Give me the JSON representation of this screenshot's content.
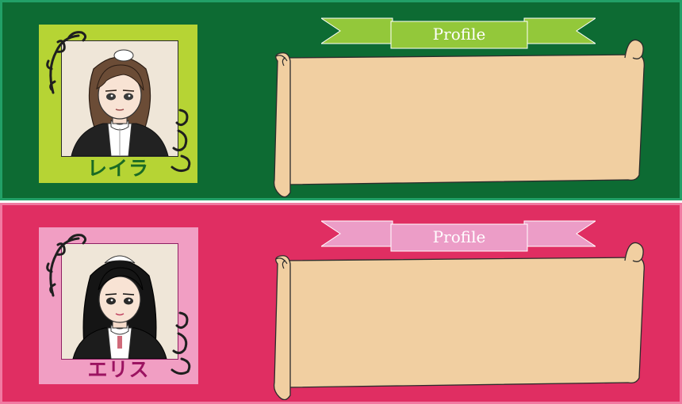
{
  "cards": [
    {
      "name": "レイラ",
      "profile_title": "Profile",
      "theme": "green",
      "colors": {
        "panel": "#0d6b33",
        "frame": "#b6d434",
        "ribbon": "#93c83a",
        "name": "#1a6a24"
      }
    },
    {
      "name": "エリス",
      "profile_title": "Profile",
      "theme": "pink",
      "colors": {
        "panel": "#e02e62",
        "frame": "#f19ec3",
        "ribbon": "#ec9dc7",
        "name": "#9c1361"
      }
    }
  ],
  "icons": [
    "maid-portrait",
    "corner-swirl-ornament",
    "ribbon-banner",
    "parchment-scroll"
  ]
}
